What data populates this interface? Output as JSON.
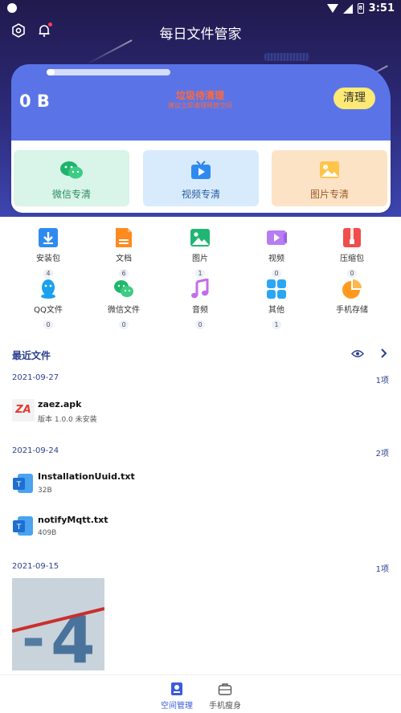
{
  "status_bar": {
    "time": "3:51",
    "battery": "8"
  },
  "header": {
    "title": "每日文件管家"
  },
  "clean": {
    "size": "0 B",
    "junk_title": "垃圾待清理",
    "junk_subtitle": "建议立即清理释放空间",
    "button_label": "清理"
  },
  "shortcuts": [
    {
      "label": "微信专清"
    },
    {
      "label": "视频专清"
    },
    {
      "label": "图片专清"
    }
  ],
  "categories": [
    {
      "label": "安装包",
      "count": "4"
    },
    {
      "label": "文档",
      "count": "6"
    },
    {
      "label": "图片",
      "count": "1"
    },
    {
      "label": "视频",
      "count": "0"
    },
    {
      "label": "压缩包",
      "count": "0"
    },
    {
      "label": "QQ文件",
      "count": "0"
    },
    {
      "label": "微信文件",
      "count": "0"
    },
    {
      "label": "音频",
      "count": "0"
    },
    {
      "label": "其他",
      "count": "1"
    },
    {
      "label": "手机存储",
      "count": ""
    }
  ],
  "recent": {
    "title": "最近文件",
    "groups": [
      {
        "date": "2021-09-27",
        "count": "1项",
        "files": [
          {
            "name": "zaez.apk",
            "meta": "版本 1.0.0   未安装",
            "icon_text": "ZA"
          }
        ]
      },
      {
        "date": "2021-09-24",
        "count": "2项",
        "files": [
          {
            "name": "InstallationUuid.txt",
            "meta": "32B"
          },
          {
            "name": "notifyMqtt.txt",
            "meta": "409B"
          }
        ]
      },
      {
        "date": "2021-09-15",
        "count": "1项",
        "image_text": "4"
      }
    ]
  },
  "bottom_nav": [
    {
      "label": "空间管理",
      "active": true
    },
    {
      "label": "手机瘦身",
      "active": false
    }
  ],
  "colors": {
    "accent": "#3b5bdb",
    "header_dark": "#201a4d",
    "card_blue": "#5a74e8",
    "clean_btn": "#fde974"
  }
}
